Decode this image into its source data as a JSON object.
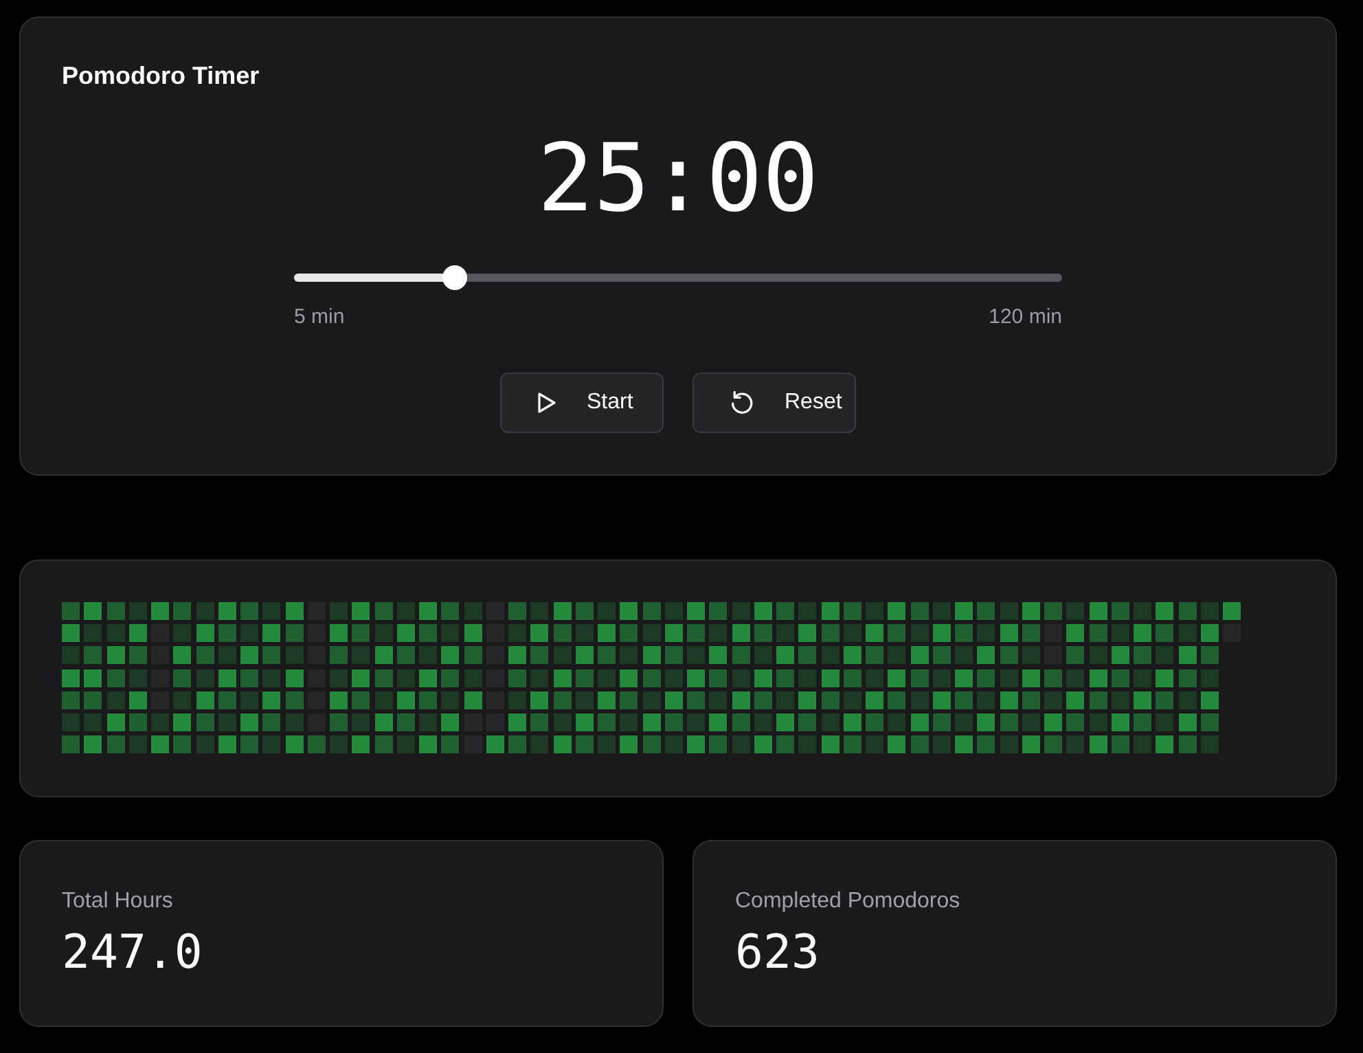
{
  "timer": {
    "title": "Pomodoro Timer",
    "time": "25:00",
    "slider": {
      "level": 0.21,
      "min_label": "5 min",
      "max_label": "120 min"
    },
    "buttons": [
      {
        "kind": "start",
        "label": "Start"
      },
      {
        "kind": "reset",
        "label": "Reset"
      }
    ]
  },
  "heatmap": {
    "weeks": [
      [
        {
          "color": "#1f5f30"
        },
        {
          "color": "#238a3c"
        },
        {
          "color": "#1d3a24"
        },
        {
          "color": "#238a3c"
        },
        {
          "color": "#1f5f30"
        },
        {
          "color": "#1d3a24"
        },
        {
          "color": "#1f5f30"
        }
      ],
      [
        {
          "color": "#238a3c"
        },
        {
          "color": "#1d3a24"
        },
        {
          "color": "#1f5f30"
        },
        {
          "color": "#238a3c"
        },
        {
          "color": "#1f5f30"
        },
        {
          "color": "#1d3a24"
        },
        {
          "color": "#238a3c"
        }
      ],
      [
        {
          "color": "#1f5f30"
        },
        {
          "color": "#1d3a24"
        },
        {
          "color": "#238a3c"
        },
        {
          "color": "#1f5f30"
        },
        {
          "color": "#1d3a24"
        },
        {
          "color": "#238a3c"
        },
        {
          "color": "#1f5f30"
        }
      ],
      [
        {
          "color": "#1d3a24"
        },
        {
          "color": "#238a3c"
        },
        {
          "color": "#1f5f30"
        },
        {
          "color": "#1d3a24"
        },
        {
          "color": "#238a3c"
        },
        {
          "color": "#1f5f30"
        },
        {
          "color": "#1d3a24"
        }
      ],
      [
        {
          "color": "#238a3c"
        },
        {
          "color": "#27272a"
        },
        {
          "color": "#27272a"
        },
        {
          "color": "#27272a"
        },
        {
          "color": "#27272a"
        },
        {
          "color": "#1d3a24"
        },
        {
          "color": "#238a3c"
        }
      ],
      [
        {
          "color": "#1f5f30"
        },
        {
          "color": "#1d3a24"
        },
        {
          "color": "#238a3c"
        },
        {
          "color": "#1f5f30"
        },
        {
          "color": "#1d3a24"
        },
        {
          "color": "#238a3c"
        },
        {
          "color": "#1f5f30"
        }
      ],
      [
        {
          "color": "#1d3a24"
        },
        {
          "color": "#238a3c"
        },
        {
          "color": "#1f5f30"
        },
        {
          "color": "#1d3a24"
        },
        {
          "color": "#238a3c"
        },
        {
          "color": "#1f5f30"
        },
        {
          "color": "#1d3a24"
        }
      ],
      [
        {
          "color": "#238a3c"
        },
        {
          "color": "#1f5f30"
        },
        {
          "color": "#1d3a24"
        },
        {
          "color": "#238a3c"
        },
        {
          "color": "#1f5f30"
        },
        {
          "color": "#1d3a24"
        },
        {
          "color": "#238a3c"
        }
      ],
      [
        {
          "color": "#1f5f30"
        },
        {
          "color": "#1d3a24"
        },
        {
          "color": "#238a3c"
        },
        {
          "color": "#1f5f30"
        },
        {
          "color": "#1d3a24"
        },
        {
          "color": "#238a3c"
        },
        {
          "color": "#1f5f30"
        }
      ],
      [
        {
          "color": "#1d3a24"
        },
        {
          "color": "#238a3c"
        },
        {
          "color": "#1f5f30"
        },
        {
          "color": "#1d3a24"
        },
        {
          "color": "#238a3c"
        },
        {
          "color": "#1f5f30"
        },
        {
          "color": "#1d3a24"
        }
      ],
      [
        {
          "color": "#238a3c"
        },
        {
          "color": "#1f5f30"
        },
        {
          "color": "#1d3a24"
        },
        {
          "color": "#238a3c"
        },
        {
          "color": "#1f5f30"
        },
        {
          "color": "#1d3a24"
        },
        {
          "color": "#238a3c"
        }
      ],
      [
        {
          "color": "#27272a"
        },
        {
          "color": "#27272a"
        },
        {
          "color": "#27272a"
        },
        {
          "color": "#27272a"
        },
        {
          "color": "#27272a"
        },
        {
          "color": "#27272a"
        },
        {
          "color": "#1f5f30"
        }
      ],
      [
        {
          "color": "#1d3a24"
        },
        {
          "color": "#238a3c"
        },
        {
          "color": "#1f5f30"
        },
        {
          "color": "#1d3a24"
        },
        {
          "color": "#238a3c"
        },
        {
          "color": "#1f5f30"
        },
        {
          "color": "#1d3a24"
        }
      ],
      [
        {
          "color": "#238a3c"
        },
        {
          "color": "#1f5f30"
        },
        {
          "color": "#1d3a24"
        },
        {
          "color": "#238a3c"
        },
        {
          "color": "#1f5f30"
        },
        {
          "color": "#1d3a24"
        },
        {
          "color": "#238a3c"
        }
      ],
      [
        {
          "color": "#1f5f30"
        },
        {
          "color": "#1d3a24"
        },
        {
          "color": "#238a3c"
        },
        {
          "color": "#1f5f30"
        },
        {
          "color": "#1d3a24"
        },
        {
          "color": "#238a3c"
        },
        {
          "color": "#1f5f30"
        }
      ],
      [
        {
          "color": "#1d3a24"
        },
        {
          "color": "#238a3c"
        },
        {
          "color": "#1f5f30"
        },
        {
          "color": "#1d3a24"
        },
        {
          "color": "#238a3c"
        },
        {
          "color": "#1f5f30"
        },
        {
          "color": "#1d3a24"
        }
      ],
      [
        {
          "color": "#238a3c"
        },
        {
          "color": "#1f5f30"
        },
        {
          "color": "#1d3a24"
        },
        {
          "color": "#238a3c"
        },
        {
          "color": "#1f5f30"
        },
        {
          "color": "#1d3a24"
        },
        {
          "color": "#238a3c"
        }
      ],
      [
        {
          "color": "#1f5f30"
        },
        {
          "color": "#1d3a24"
        },
        {
          "color": "#238a3c"
        },
        {
          "color": "#1f5f30"
        },
        {
          "color": "#1d3a24"
        },
        {
          "color": "#238a3c"
        },
        {
          "color": "#1f5f30"
        }
      ],
      [
        {
          "color": "#1d3a24"
        },
        {
          "color": "#238a3c"
        },
        {
          "color": "#1f5f30"
        },
        {
          "color": "#1d3a24"
        },
        {
          "color": "#238a3c"
        },
        {
          "color": "#27272a"
        },
        {
          "color": "#27272a"
        }
      ],
      [
        {
          "color": "#27272a"
        },
        {
          "color": "#27272a"
        },
        {
          "color": "#27272a"
        },
        {
          "color": "#27272a"
        },
        {
          "color": "#27272a"
        },
        {
          "color": "#27272a"
        },
        {
          "color": "#238a3c"
        }
      ],
      [
        {
          "color": "#1f5f30"
        },
        {
          "color": "#1d3a24"
        },
        {
          "color": "#238a3c"
        },
        {
          "color": "#1f5f30"
        },
        {
          "color": "#1d3a24"
        },
        {
          "color": "#238a3c"
        },
        {
          "color": "#1f5f30"
        }
      ],
      [
        {
          "color": "#1d3a24"
        },
        {
          "color": "#238a3c"
        },
        {
          "color": "#1f5f30"
        },
        {
          "color": "#1d3a24"
        },
        {
          "color": "#238a3c"
        },
        {
          "color": "#1f5f30"
        },
        {
          "color": "#1d3a24"
        }
      ],
      [
        {
          "color": "#238a3c"
        },
        {
          "color": "#1f5f30"
        },
        {
          "color": "#1d3a24"
        },
        {
          "color": "#238a3c"
        },
        {
          "color": "#1f5f30"
        },
        {
          "color": "#1d3a24"
        },
        {
          "color": "#238a3c"
        }
      ],
      [
        {
          "color": "#1f5f30"
        },
        {
          "color": "#1d3a24"
        },
        {
          "color": "#238a3c"
        },
        {
          "color": "#1f5f30"
        },
        {
          "color": "#1d3a24"
        },
        {
          "color": "#238a3c"
        },
        {
          "color": "#1f5f30"
        }
      ],
      [
        {
          "color": "#1d3a24"
        },
        {
          "color": "#238a3c"
        },
        {
          "color": "#1f5f30"
        },
        {
          "color": "#1d3a24"
        },
        {
          "color": "#238a3c"
        },
        {
          "color": "#1f5f30"
        },
        {
          "color": "#1d3a24"
        }
      ],
      [
        {
          "color": "#238a3c"
        },
        {
          "color": "#1f5f30"
        },
        {
          "color": "#1d3a24"
        },
        {
          "color": "#238a3c"
        },
        {
          "color": "#1f5f30"
        },
        {
          "color": "#1d3a24"
        },
        {
          "color": "#238a3c"
        }
      ],
      [
        {
          "color": "#1f5f30"
        },
        {
          "color": "#1d3a24"
        },
        {
          "color": "#238a3c"
        },
        {
          "color": "#1f5f30"
        },
        {
          "color": "#1d3a24"
        },
        {
          "color": "#238a3c"
        },
        {
          "color": "#1f5f30"
        }
      ],
      [
        {
          "color": "#1d3a24"
        },
        {
          "color": "#238a3c"
        },
        {
          "color": "#1f5f30"
        },
        {
          "color": "#1d3a24"
        },
        {
          "color": "#238a3c"
        },
        {
          "color": "#1f5f30"
        },
        {
          "color": "#1d3a24"
        }
      ],
      [
        {
          "color": "#238a3c"
        },
        {
          "color": "#1f5f30"
        },
        {
          "color": "#1d3a24"
        },
        {
          "color": "#238a3c"
        },
        {
          "color": "#1f5f30"
        },
        {
          "color": "#1d3a24"
        },
        {
          "color": "#238a3c"
        }
      ],
      [
        {
          "color": "#1f5f30"
        },
        {
          "color": "#1d3a24"
        },
        {
          "color": "#238a3c"
        },
        {
          "color": "#1f5f30"
        },
        {
          "color": "#1d3a24"
        },
        {
          "color": "#238a3c"
        },
        {
          "color": "#1f5f30"
        }
      ],
      [
        {
          "color": "#1d3a24"
        },
        {
          "color": "#238a3c"
        },
        {
          "color": "#1f5f30"
        },
        {
          "color": "#1d3a24"
        },
        {
          "color": "#238a3c"
        },
        {
          "color": "#1f5f30"
        },
        {
          "color": "#1d3a24"
        }
      ],
      [
        {
          "color": "#238a3c"
        },
        {
          "color": "#1f5f30"
        },
        {
          "color": "#1d3a24"
        },
        {
          "color": "#238a3c"
        },
        {
          "color": "#1f5f30"
        },
        {
          "color": "#1d3a24"
        },
        {
          "color": "#238a3c"
        }
      ],
      [
        {
          "color": "#1f5f30"
        },
        {
          "color": "#1d3a24"
        },
        {
          "color": "#238a3c"
        },
        {
          "color": "#1f5f30"
        },
        {
          "color": "#1d3a24"
        },
        {
          "color": "#238a3c"
        },
        {
          "color": "#1f5f30"
        }
      ],
      [
        {
          "color": "#1d3a24"
        },
        {
          "color": "#238a3c"
        },
        {
          "color": "#1f5f30"
        },
        {
          "color": "#1d3a24"
        },
        {
          "color": "#238a3c"
        },
        {
          "color": "#1f5f30"
        },
        {
          "color": "#1d3a24"
        }
      ],
      [
        {
          "color": "#238a3c"
        },
        {
          "color": "#1f5f30"
        },
        {
          "color": "#1d3a24"
        },
        {
          "color": "#238a3c"
        },
        {
          "color": "#1f5f30"
        },
        {
          "color": "#1d3a24"
        },
        {
          "color": "#238a3c"
        }
      ],
      [
        {
          "color": "#1f5f30"
        },
        {
          "color": "#1d3a24"
        },
        {
          "color": "#238a3c"
        },
        {
          "color": "#1f5f30"
        },
        {
          "color": "#1d3a24"
        },
        {
          "color": "#238a3c"
        },
        {
          "color": "#1f5f30"
        }
      ],
      [
        {
          "color": "#1d3a24"
        },
        {
          "color": "#238a3c"
        },
        {
          "color": "#1f5f30"
        },
        {
          "color": "#1d3a24"
        },
        {
          "color": "#238a3c"
        },
        {
          "color": "#1f5f30"
        },
        {
          "color": "#1d3a24"
        }
      ],
      [
        {
          "color": "#238a3c"
        },
        {
          "color": "#1f5f30"
        },
        {
          "color": "#1d3a24"
        },
        {
          "color": "#238a3c"
        },
        {
          "color": "#1f5f30"
        },
        {
          "color": "#1d3a24"
        },
        {
          "color": "#238a3c"
        }
      ],
      [
        {
          "color": "#1f5f30"
        },
        {
          "color": "#1d3a24"
        },
        {
          "color": "#238a3c"
        },
        {
          "color": "#1f5f30"
        },
        {
          "color": "#1d3a24"
        },
        {
          "color": "#238a3c"
        },
        {
          "color": "#1f5f30"
        }
      ],
      [
        {
          "color": "#1d3a24"
        },
        {
          "color": "#238a3c"
        },
        {
          "color": "#1f5f30"
        },
        {
          "color": "#1d3a24"
        },
        {
          "color": "#238a3c"
        },
        {
          "color": "#1f5f30"
        },
        {
          "color": "#1d3a24"
        }
      ],
      [
        {
          "color": "#238a3c"
        },
        {
          "color": "#1f5f30"
        },
        {
          "color": "#1d3a24"
        },
        {
          "color": "#238a3c"
        },
        {
          "color": "#1f5f30"
        },
        {
          "color": "#1d3a24"
        },
        {
          "color": "#238a3c"
        }
      ],
      [
        {
          "color": "#1f5f30"
        },
        {
          "color": "#1d3a24"
        },
        {
          "color": "#238a3c"
        },
        {
          "color": "#1f5f30"
        },
        {
          "color": "#1d3a24"
        },
        {
          "color": "#238a3c"
        },
        {
          "color": "#1f5f30"
        }
      ],
      [
        {
          "color": "#1d3a24"
        },
        {
          "color": "#238a3c"
        },
        {
          "color": "#1f5f30"
        },
        {
          "color": "#1d3a24"
        },
        {
          "color": "#238a3c"
        },
        {
          "color": "#1f5f30"
        },
        {
          "color": "#1d3a24"
        }
      ],
      [
        {
          "color": "#238a3c"
        },
        {
          "color": "#1f5f30"
        },
        {
          "color": "#1d3a24"
        },
        {
          "color": "#238a3c"
        },
        {
          "color": "#1f5f30"
        },
        {
          "color": "#1d3a24"
        },
        {
          "color": "#238a3c"
        }
      ],
      [
        {
          "color": "#1f5f30"
        },
        {
          "color": "#27272a"
        },
        {
          "color": "#27272a"
        },
        {
          "color": "#1f5f30"
        },
        {
          "color": "#1d3a24"
        },
        {
          "color": "#238a3c"
        },
        {
          "color": "#1f5f30"
        }
      ],
      [
        {
          "color": "#1d3a24"
        },
        {
          "color": "#238a3c"
        },
        {
          "color": "#1f5f30"
        },
        {
          "color": "#1d3a24"
        },
        {
          "color": "#238a3c"
        },
        {
          "color": "#1f5f30"
        },
        {
          "color": "#1d3a24"
        }
      ],
      [
        {
          "color": "#238a3c"
        },
        {
          "color": "#1f5f30"
        },
        {
          "color": "#1d3a24"
        },
        {
          "color": "#238a3c"
        },
        {
          "color": "#1f5f30"
        },
        {
          "color": "#1d3a24"
        },
        {
          "color": "#238a3c"
        }
      ],
      [
        {
          "color": "#1f5f30"
        },
        {
          "color": "#1d3a24"
        },
        {
          "color": "#238a3c"
        },
        {
          "color": "#1f5f30"
        },
        {
          "color": "#1d3a24"
        },
        {
          "color": "#238a3c"
        },
        {
          "color": "#1f5f30"
        }
      ],
      [
        {
          "color": "#1d3a24"
        },
        {
          "color": "#238a3c"
        },
        {
          "color": "#1f5f30"
        },
        {
          "color": "#1d3a24"
        },
        {
          "color": "#238a3c"
        },
        {
          "color": "#1f5f30"
        },
        {
          "color": "#1d3a24"
        }
      ],
      [
        {
          "color": "#238a3c"
        },
        {
          "color": "#1f5f30"
        },
        {
          "color": "#1d3a24"
        },
        {
          "color": "#238a3c"
        },
        {
          "color": "#1f5f30"
        },
        {
          "color": "#1d3a24"
        },
        {
          "color": "#238a3c"
        }
      ],
      [
        {
          "color": "#1f5f30"
        },
        {
          "color": "#1d3a24"
        },
        {
          "color": "#238a3c"
        },
        {
          "color": "#1f5f30"
        },
        {
          "color": "#1d3a24"
        },
        {
          "color": "#238a3c"
        },
        {
          "color": "#1f5f30"
        }
      ],
      [
        {
          "color": "#1d3a24"
        },
        {
          "color": "#238a3c"
        },
        {
          "color": "#1f5f30"
        },
        {
          "color": "#1d3a24"
        },
        {
          "color": "#238a3c"
        },
        {
          "color": "#1f5f30"
        },
        {
          "color": "#1d3a24"
        }
      ],
      [
        {
          "color": "#238a3c"
        },
        {
          "color": "#27272a"
        }
      ]
    ]
  },
  "stats": [
    {
      "label": "Total Hours",
      "value": "247.0"
    },
    {
      "label": "Completed Pomodoros",
      "value": "623"
    }
  ]
}
